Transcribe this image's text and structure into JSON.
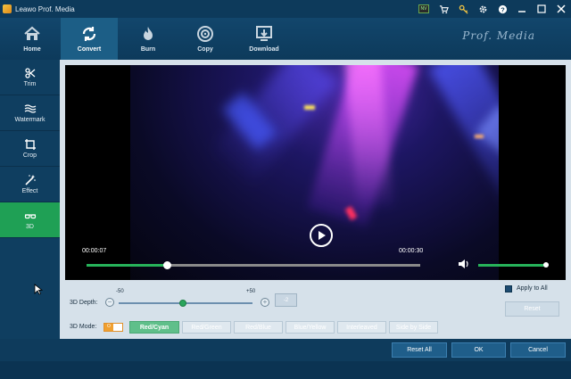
{
  "app": {
    "title": "Leawo Prof. Media",
    "brand": "Prof. Media"
  },
  "toolbar": {
    "tabs": [
      {
        "label": "Home",
        "icon": "home-icon"
      },
      {
        "label": "Convert",
        "icon": "convert-icon",
        "active": true
      },
      {
        "label": "Burn",
        "icon": "burn-icon"
      },
      {
        "label": "Copy",
        "icon": "copy-icon"
      },
      {
        "label": "Download",
        "icon": "download-icon"
      }
    ]
  },
  "sidebar": {
    "items": [
      {
        "label": "Trim",
        "icon": "scissors-icon"
      },
      {
        "label": "Watermark",
        "icon": "watermark-icon"
      },
      {
        "label": "Crop",
        "icon": "crop-icon"
      },
      {
        "label": "Effect",
        "icon": "effect-icon"
      },
      {
        "label": "3D",
        "icon": "3d-glasses-icon",
        "active": true
      }
    ]
  },
  "player": {
    "current_time": "00:00:07",
    "total_time": "00:00:30",
    "progress_fraction": 0.24,
    "volume_fraction": 1.0
  },
  "depth": {
    "label": "3D Depth:",
    "min_label": "-50",
    "max_label": "+50",
    "value": "-2",
    "min": -50,
    "max": 50,
    "current": -2,
    "minus_glyph": "−",
    "plus_glyph": "+"
  },
  "apply_to_all": {
    "label": "Apply to All",
    "checked": true
  },
  "reset_label": "Reset",
  "mode": {
    "label": "3D Mode:",
    "toggle_text": "O",
    "options": [
      "Red/Cyan",
      "Red/Green",
      "Red/Blue",
      "Blue/Yellow",
      "Interleaved",
      "Side by Side"
    ],
    "selected": "Red/Cyan"
  },
  "footer": {
    "reset_all": "Reset All",
    "ok": "OK",
    "cancel": "Cancel"
  },
  "colors": {
    "accent_green": "#1fa055",
    "dark_blue": "#0e3b5c",
    "panel": "#d6e1ea"
  }
}
